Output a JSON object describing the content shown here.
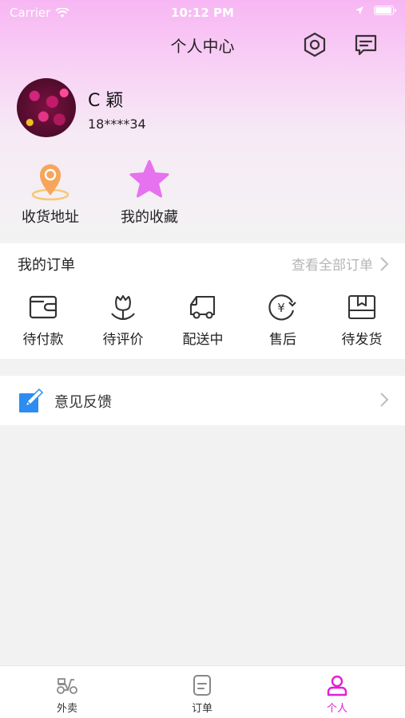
{
  "status_bar": {
    "carrier": "Carrier",
    "time": "10:12 PM"
  },
  "nav": {
    "title": "个人中心"
  },
  "profile": {
    "name": "C 颖",
    "phone": "18****34"
  },
  "quick_actions": [
    {
      "label": "收货地址",
      "icon": "location-pin-icon"
    },
    {
      "label": "我的收藏",
      "icon": "star-icon"
    }
  ],
  "orders": {
    "title": "我的订单",
    "view_all": "查看全部订单",
    "items": [
      {
        "label": "待付款",
        "icon": "wallet-icon"
      },
      {
        "label": "待评价",
        "icon": "flower-icon"
      },
      {
        "label": "配送中",
        "icon": "delivery-truck-icon"
      },
      {
        "label": "售后",
        "icon": "yen-refund-icon"
      },
      {
        "label": "待发货",
        "icon": "package-box-icon"
      }
    ]
  },
  "feedback": {
    "label": "意见反馈",
    "icon": "edit-pen-icon"
  },
  "tabbar": {
    "active_color": "#e21fd6",
    "items": [
      {
        "label": "外卖",
        "icon": "scooter-icon"
      },
      {
        "label": "订单",
        "icon": "document-icon"
      },
      {
        "label": "个人",
        "icon": "user-icon"
      }
    ]
  }
}
